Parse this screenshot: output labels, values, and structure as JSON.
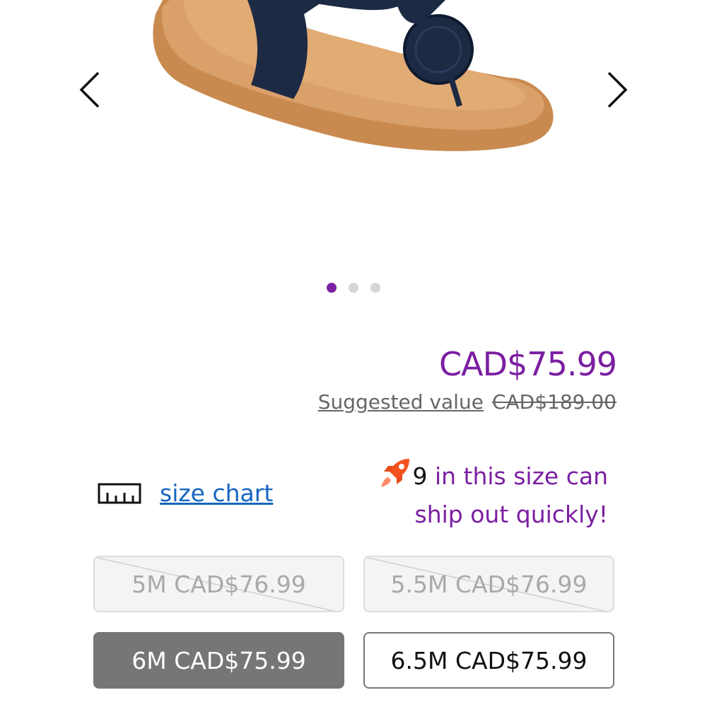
{
  "carousel": {
    "image_alt": "Navy leather thong sandal with tan footbed",
    "prev_icon": "chevron-left-icon",
    "next_icon": "chevron-right-icon",
    "dots": [
      {
        "active": true
      },
      {
        "active": false
      },
      {
        "active": false
      }
    ]
  },
  "pricing": {
    "price": "CAD$75.99",
    "suggested_label": "Suggested value",
    "suggested_price": "CAD$189.00"
  },
  "size_chart": {
    "icon": "ruler-icon",
    "label": "size chart"
  },
  "shipping": {
    "icon": "rocket-icon",
    "count": "9",
    "message": " in this size can ship out quickly!"
  },
  "sizes": [
    {
      "label": "5M CAD$76.99",
      "state": "unavailable"
    },
    {
      "label": "5.5M CAD$76.99",
      "state": "unavailable"
    },
    {
      "label": "6M CAD$75.99",
      "state": "selected"
    },
    {
      "label": "6.5M CAD$75.99",
      "state": "available"
    }
  ],
  "colors": {
    "accent": "#7b1fa2",
    "link": "#1565c0",
    "selected_bg": "#767676"
  }
}
